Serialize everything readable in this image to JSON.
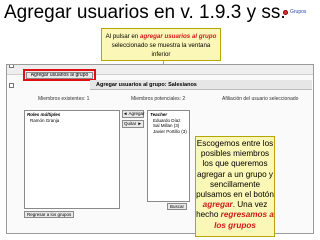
{
  "header": {
    "title": "Agregar usuarios en v. 1.9.3 y ss.",
    "corner_link": "Grupos"
  },
  "callout_top": {
    "part1": "Al pulsar en ",
    "highlight": "agregar usuarios al grupo",
    "part2": " seleccionado se muestra la ventana inferior"
  },
  "screenshot": {
    "add_users_button": "Agregar usuarios al grupo",
    "group_title": "Agregar usuarios al grupo: Salesianos",
    "columns": {
      "existing": "Miembros existentes: 1",
      "potential": "Miembros potenciales: 2",
      "affiliation": "Afiliación del usuario seleccionado"
    },
    "existing_list": {
      "group_label": "Roles múltiples",
      "items": [
        "Ramón Granja"
      ]
    },
    "potential_list": {
      "group_label": "Teacher",
      "items": [
        "Eduardo Díaz Sal Millan (3)",
        "Javier Portillo (3)"
      ]
    },
    "add_button": "◄ Agregar",
    "remove_button": "Quitar ►",
    "search_button": "Buscar",
    "back_button": "Regresar a los grupos"
  },
  "callout_right": {
    "part1": "Escogemos entre los posibles miembros los que queremos agregar a un grupo y sencillamente pulsamos en el botón ",
    "highlight1": "agregar",
    "part2": ". Una vez hecho ",
    "highlight2": "regresamos a los grupos"
  },
  "colors": {
    "callout_bg": "#fbf7b6",
    "highlight": "#d11a1a",
    "focus_box": "#e01010"
  }
}
